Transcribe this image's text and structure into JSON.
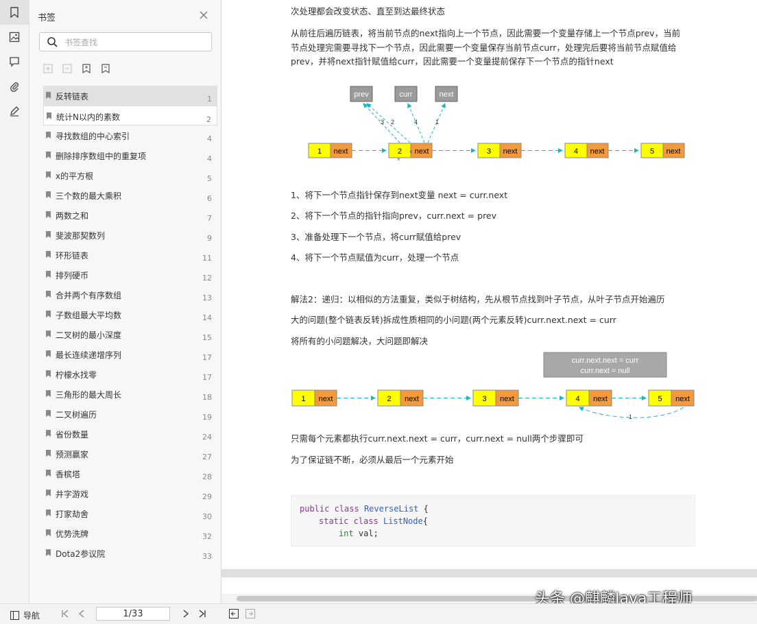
{
  "panel": {
    "title": "书签",
    "search_placeholder": "书签查找"
  },
  "bookmarks": [
    {
      "label": "反转链表",
      "page": "1"
    },
    {
      "label": "统计N以内的素数",
      "page": "2"
    },
    {
      "label": "寻找数组的中心索引",
      "page": "4"
    },
    {
      "label": "删除排序数组中的重复项",
      "page": "4"
    },
    {
      "label": "x的平方根",
      "page": "5"
    },
    {
      "label": "三个数的最大乘积",
      "page": "6"
    },
    {
      "label": "两数之和",
      "page": "7"
    },
    {
      "label": "斐波那契数列",
      "page": "9"
    },
    {
      "label": "环形链表",
      "page": "11"
    },
    {
      "label": "排列硬币",
      "page": "12"
    },
    {
      "label": "合并两个有序数组",
      "page": "13"
    },
    {
      "label": "子数组最大平均数",
      "page": "14"
    },
    {
      "label": "二叉树的最小深度",
      "page": "15"
    },
    {
      "label": "最长连续递增序列",
      "page": "17"
    },
    {
      "label": "柠檬水找零",
      "page": "17"
    },
    {
      "label": "三角形的最大周长",
      "page": "18"
    },
    {
      "label": "二叉树遍历",
      "page": "19"
    },
    {
      "label": "省份数量",
      "page": "24"
    },
    {
      "label": "预测赢家",
      "page": "27"
    },
    {
      "label": "香槟塔",
      "page": "28"
    },
    {
      "label": "井字游戏",
      "page": "29"
    },
    {
      "label": "打家劫舍",
      "page": "30"
    },
    {
      "label": "优势洗牌",
      "page": "32"
    },
    {
      "label": "Dota2参议院",
      "page": "33"
    }
  ],
  "doc": {
    "line_top": "次处理都会改变状态、直至到达最终状态",
    "para1_l1": "从前往后遍历链表，将当前节点的next指向上一个节点，因此需要一个变量存储上一个节点prev，当前",
    "para1_l2": "节点处理完需要寻找下一个节点，因此需要一个变量保存当前节点curr，处理完后要将当前节点赋值给",
    "para1_l3": "prev，并将next指针赋值给curr，因此需要一个变量提前保存下一个节点的指针next",
    "step1": "1、将下一个节点指针保存到next变量 next = curr.next",
    "step2": "2、将下一个节点的指针指向prev，curr.next = prev",
    "step3": "3、准备处理下一个节点，将curr赋值给prev",
    "step4": "4、将下一个节点赋值为curr，处理一个节点",
    "sol2_l1": "解法2：递归：以相似的方法重复，类似于树结构，先从根节点找到叶子节点，从叶子节点开始遍历",
    "sol2_l2": "大的问题(整个链表反转)拆成性质相同的小问题(两个元素反转)curr.next.next = curr",
    "sol2_l3": "将所有的小问题解决，大问题即解决",
    "note1": "只需每个元素都执行curr.next.next = curr，curr.next = null两个步骤即可",
    "note2": "为了保证链不断，必须从最后一个元素开始",
    "code_l1_kw": "public class",
    "code_l1_name": "ReverseList",
    "code_l1_end": "{",
    "code_l2_kw": "static class",
    "code_l2_name": "ListNode",
    "code_l2_end": "{",
    "code_l3_kw": "int",
    "code_l3_end": "val;"
  },
  "diagram1": {
    "vars": [
      "prev",
      "curr",
      "next"
    ],
    "nodes": [
      "1",
      "2",
      "3",
      "4",
      "5"
    ],
    "next_label": "next",
    "step_labels": [
      "3",
      "2",
      "4",
      "1"
    ],
    "cross": "×"
  },
  "diagram2": {
    "box_l1": "curr.next.next = curr",
    "box_l2": "curr.next = null",
    "nodes": [
      "1",
      "2",
      "3",
      "4",
      "5"
    ],
    "next_label": "next",
    "arc_label": "1"
  },
  "watermark": "头条 @麒麟Java工程师",
  "statusbar": {
    "nav_label": "导航",
    "page_display": "1/33"
  },
  "colors": {
    "node_yellow": "#ffff00",
    "node_orange": "#f39a3c",
    "arrow_teal": "#1eb5c0",
    "var_gray": "#9b9b9b"
  }
}
